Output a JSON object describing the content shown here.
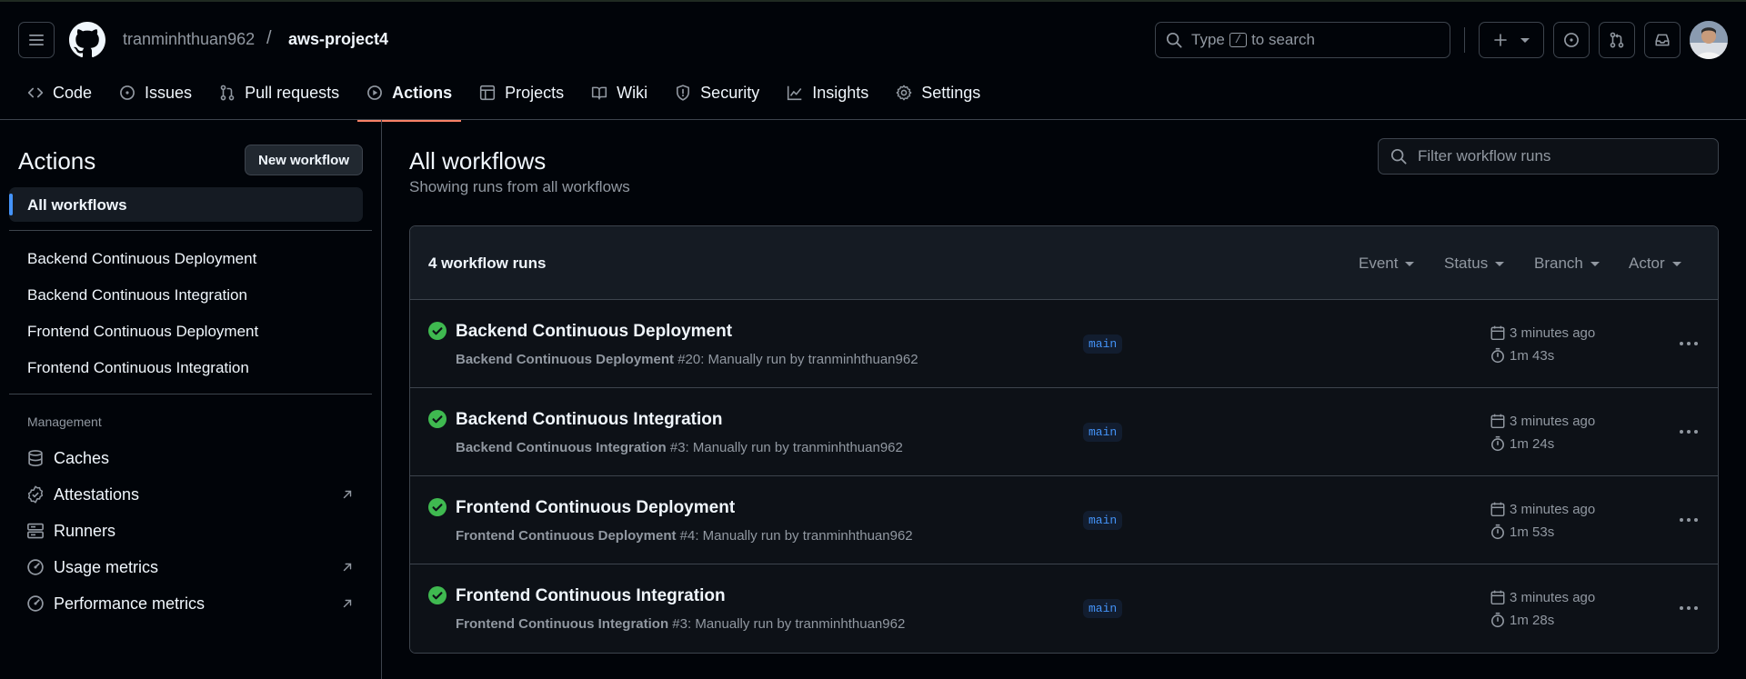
{
  "header": {
    "owner": "tranminhthuan962",
    "separator": "/",
    "repo": "aws-project4",
    "search": {
      "prefix": "Type",
      "key": "/",
      "suffix": "to search"
    },
    "icons": [
      "menu-icon",
      "github-logo-icon",
      "search-icon",
      "plus-icon",
      "issue-opened-icon",
      "git-pull-request-icon",
      "inbox-icon"
    ]
  },
  "tabs": [
    {
      "label": "Code",
      "icon": "code-icon"
    },
    {
      "label": "Issues",
      "icon": "issue-opened-icon"
    },
    {
      "label": "Pull requests",
      "icon": "git-pull-request-icon"
    },
    {
      "label": "Actions",
      "icon": "play-icon",
      "active": true
    },
    {
      "label": "Projects",
      "icon": "table-icon"
    },
    {
      "label": "Wiki",
      "icon": "book-icon"
    },
    {
      "label": "Security",
      "icon": "shield-icon"
    },
    {
      "label": "Insights",
      "icon": "graph-icon"
    },
    {
      "label": "Settings",
      "icon": "gear-icon"
    }
  ],
  "sidebar": {
    "title": "Actions",
    "new_workflow": "New workflow",
    "all_workflows": "All workflows",
    "workflows": [
      "Backend Continuous Deployment",
      "Backend Continuous Integration",
      "Frontend Continuous Deployment",
      "Frontend Continuous Integration"
    ],
    "management_heading": "Management",
    "management": [
      {
        "label": "Caches",
        "icon": "database-icon",
        "external": false
      },
      {
        "label": "Attestations",
        "icon": "verified-icon",
        "external": true
      },
      {
        "label": "Runners",
        "icon": "server-icon",
        "external": false
      },
      {
        "label": "Usage metrics",
        "icon": "meter-icon",
        "external": true
      },
      {
        "label": "Performance metrics",
        "icon": "meter-icon",
        "external": true
      }
    ]
  },
  "main": {
    "title": "All workflows",
    "subtitle": "Showing runs from all workflows",
    "filter_placeholder": "Filter workflow runs",
    "runs_count": "4 workflow runs",
    "filters": [
      "Event",
      "Status",
      "Branch",
      "Actor"
    ],
    "runs": [
      {
        "title": "Backend Continuous Deployment",
        "workflow": "Backend Continuous Deployment",
        "meta": " #20: Manually run by tranminhthuan962",
        "branch": "main",
        "time": "3 minutes ago",
        "duration": "1m 43s",
        "status": "success"
      },
      {
        "title": "Backend Continuous Integration",
        "workflow": "Backend Continuous Integration",
        "meta": " #3: Manually run by tranminhthuan962",
        "branch": "main",
        "time": "3 minutes ago",
        "duration": "1m 24s",
        "status": "success"
      },
      {
        "title": "Frontend Continuous Deployment",
        "workflow": "Frontend Continuous Deployment",
        "meta": " #4: Manually run by tranminhthuan962",
        "branch": "main",
        "time": "3 minutes ago",
        "duration": "1m 53s",
        "status": "success"
      },
      {
        "title": "Frontend Continuous Integration",
        "workflow": "Frontend Continuous Integration",
        "meta": " #3: Manually run by tranminhthuan962",
        "branch": "main",
        "time": "3 minutes ago",
        "duration": "1m 28s",
        "status": "success"
      }
    ]
  },
  "colors": {
    "accent_tab": "#f78166",
    "link_blue": "#4493f8",
    "success": "#3fb950"
  }
}
